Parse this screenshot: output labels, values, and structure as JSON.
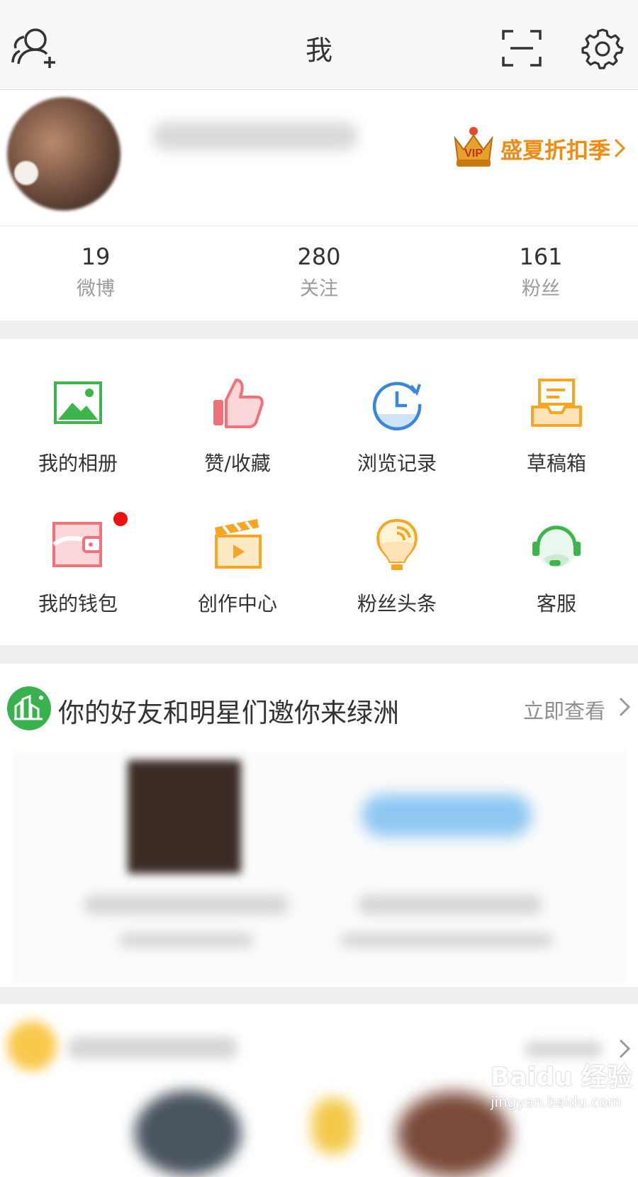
{
  "header": {
    "title": "我"
  },
  "profile": {
    "promo_label": "盛夏折扣季"
  },
  "stats": [
    {
      "value": "19",
      "label": "微博"
    },
    {
      "value": "280",
      "label": "关注"
    },
    {
      "value": "161",
      "label": "粉丝"
    }
  ],
  "grid": [
    {
      "label": "我的相册",
      "icon": "photo-album-icon"
    },
    {
      "label": "赞/收藏",
      "icon": "thumbs-up-icon"
    },
    {
      "label": "浏览记录",
      "icon": "history-clock-icon"
    },
    {
      "label": "草稿箱",
      "icon": "drafts-tray-icon"
    },
    {
      "label": "我的钱包",
      "icon": "wallet-icon",
      "badge": true
    },
    {
      "label": "创作中心",
      "icon": "clapperboard-icon"
    },
    {
      "label": "粉丝头条",
      "icon": "lightbulb-icon"
    },
    {
      "label": "客服",
      "icon": "headset-icon"
    }
  ],
  "oasis": {
    "title": "你的好友和明星们邀你来绿洲",
    "link_label": "立即查看"
  },
  "watermark": {
    "brand": "Baidu 经验",
    "url": "jingyan.baidu.com"
  },
  "colors": {
    "accent_orange": "#f08a12",
    "green": "#3cb54a",
    "red_badge": "#f01010"
  }
}
